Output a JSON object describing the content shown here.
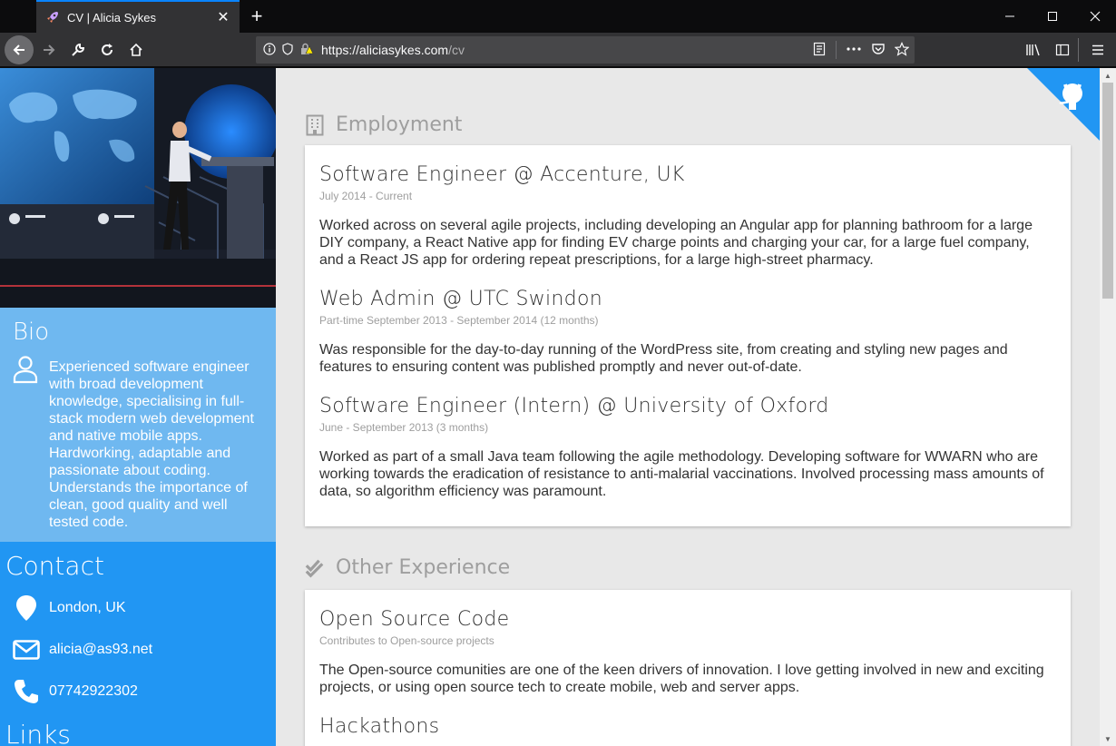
{
  "browser": {
    "tab_title": "CV | Alicia Sykes",
    "url_domain": "https://aliciasykes.com",
    "url_path": "/cv"
  },
  "colors": {
    "bio_bg": "#6fb8f0",
    "contact_bg": "#2196f3",
    "page_bg": "#e8e8e8",
    "accent": "#2196f3"
  },
  "sidebar": {
    "bio": {
      "heading": "Bio",
      "text": "Experienced software engineer with broad development knowledge, specialising in full-stack modern web development and native mobile apps. Hardworking, adaptable and passionate about coding. Understands the importance of clean, good quality and well tested code."
    },
    "contact": {
      "heading": "Contact",
      "location": "London, UK",
      "email": "alicia@as93.net",
      "phone": "07742922302"
    },
    "links_heading": "Links"
  },
  "employment": {
    "heading": "Employment",
    "jobs": [
      {
        "title": "Software Engineer @ Accenture, UK",
        "dates": "July 2014 - Current",
        "desc": "Worked across on several agile projects, including developing an Angular app for planning bathroom for a large DIY company, a React Native app for finding EV charge points and charging your car, for a large fuel company, and a React JS app for ordering repeat prescriptions, for a large high-street pharmacy."
      },
      {
        "title": "Web Admin @ UTC Swindon",
        "dates": "Part-time September 2013 - September 2014 (12 months)",
        "desc": "Was responsible for the day-to-day running of the WordPress site, from creating and styling new pages and features to ensuring content was published promptly and never out-of-date."
      },
      {
        "title": "Software Engineer (Intern) @ University of Oxford",
        "dates": "June - September 2013 (3 months)",
        "desc": "Worked as part of a small Java team following the agile methodology. Developing software for WWARN who are working towards the eradication of resistance to anti-malarial vaccinations. Involved processing mass amounts of data, so algorithm efficiency was paramount."
      }
    ]
  },
  "other": {
    "heading": "Other Experience",
    "items": [
      {
        "title": "Open Source Code",
        "sub": "Contributes to Open-source projects",
        "desc": "The Open-source comunities are one of the keen drivers of innovation. I love getting involved in new and exciting projects, or using open source tech to create mobile, web and server apps."
      },
      {
        "title": "Hackathons"
      }
    ]
  }
}
